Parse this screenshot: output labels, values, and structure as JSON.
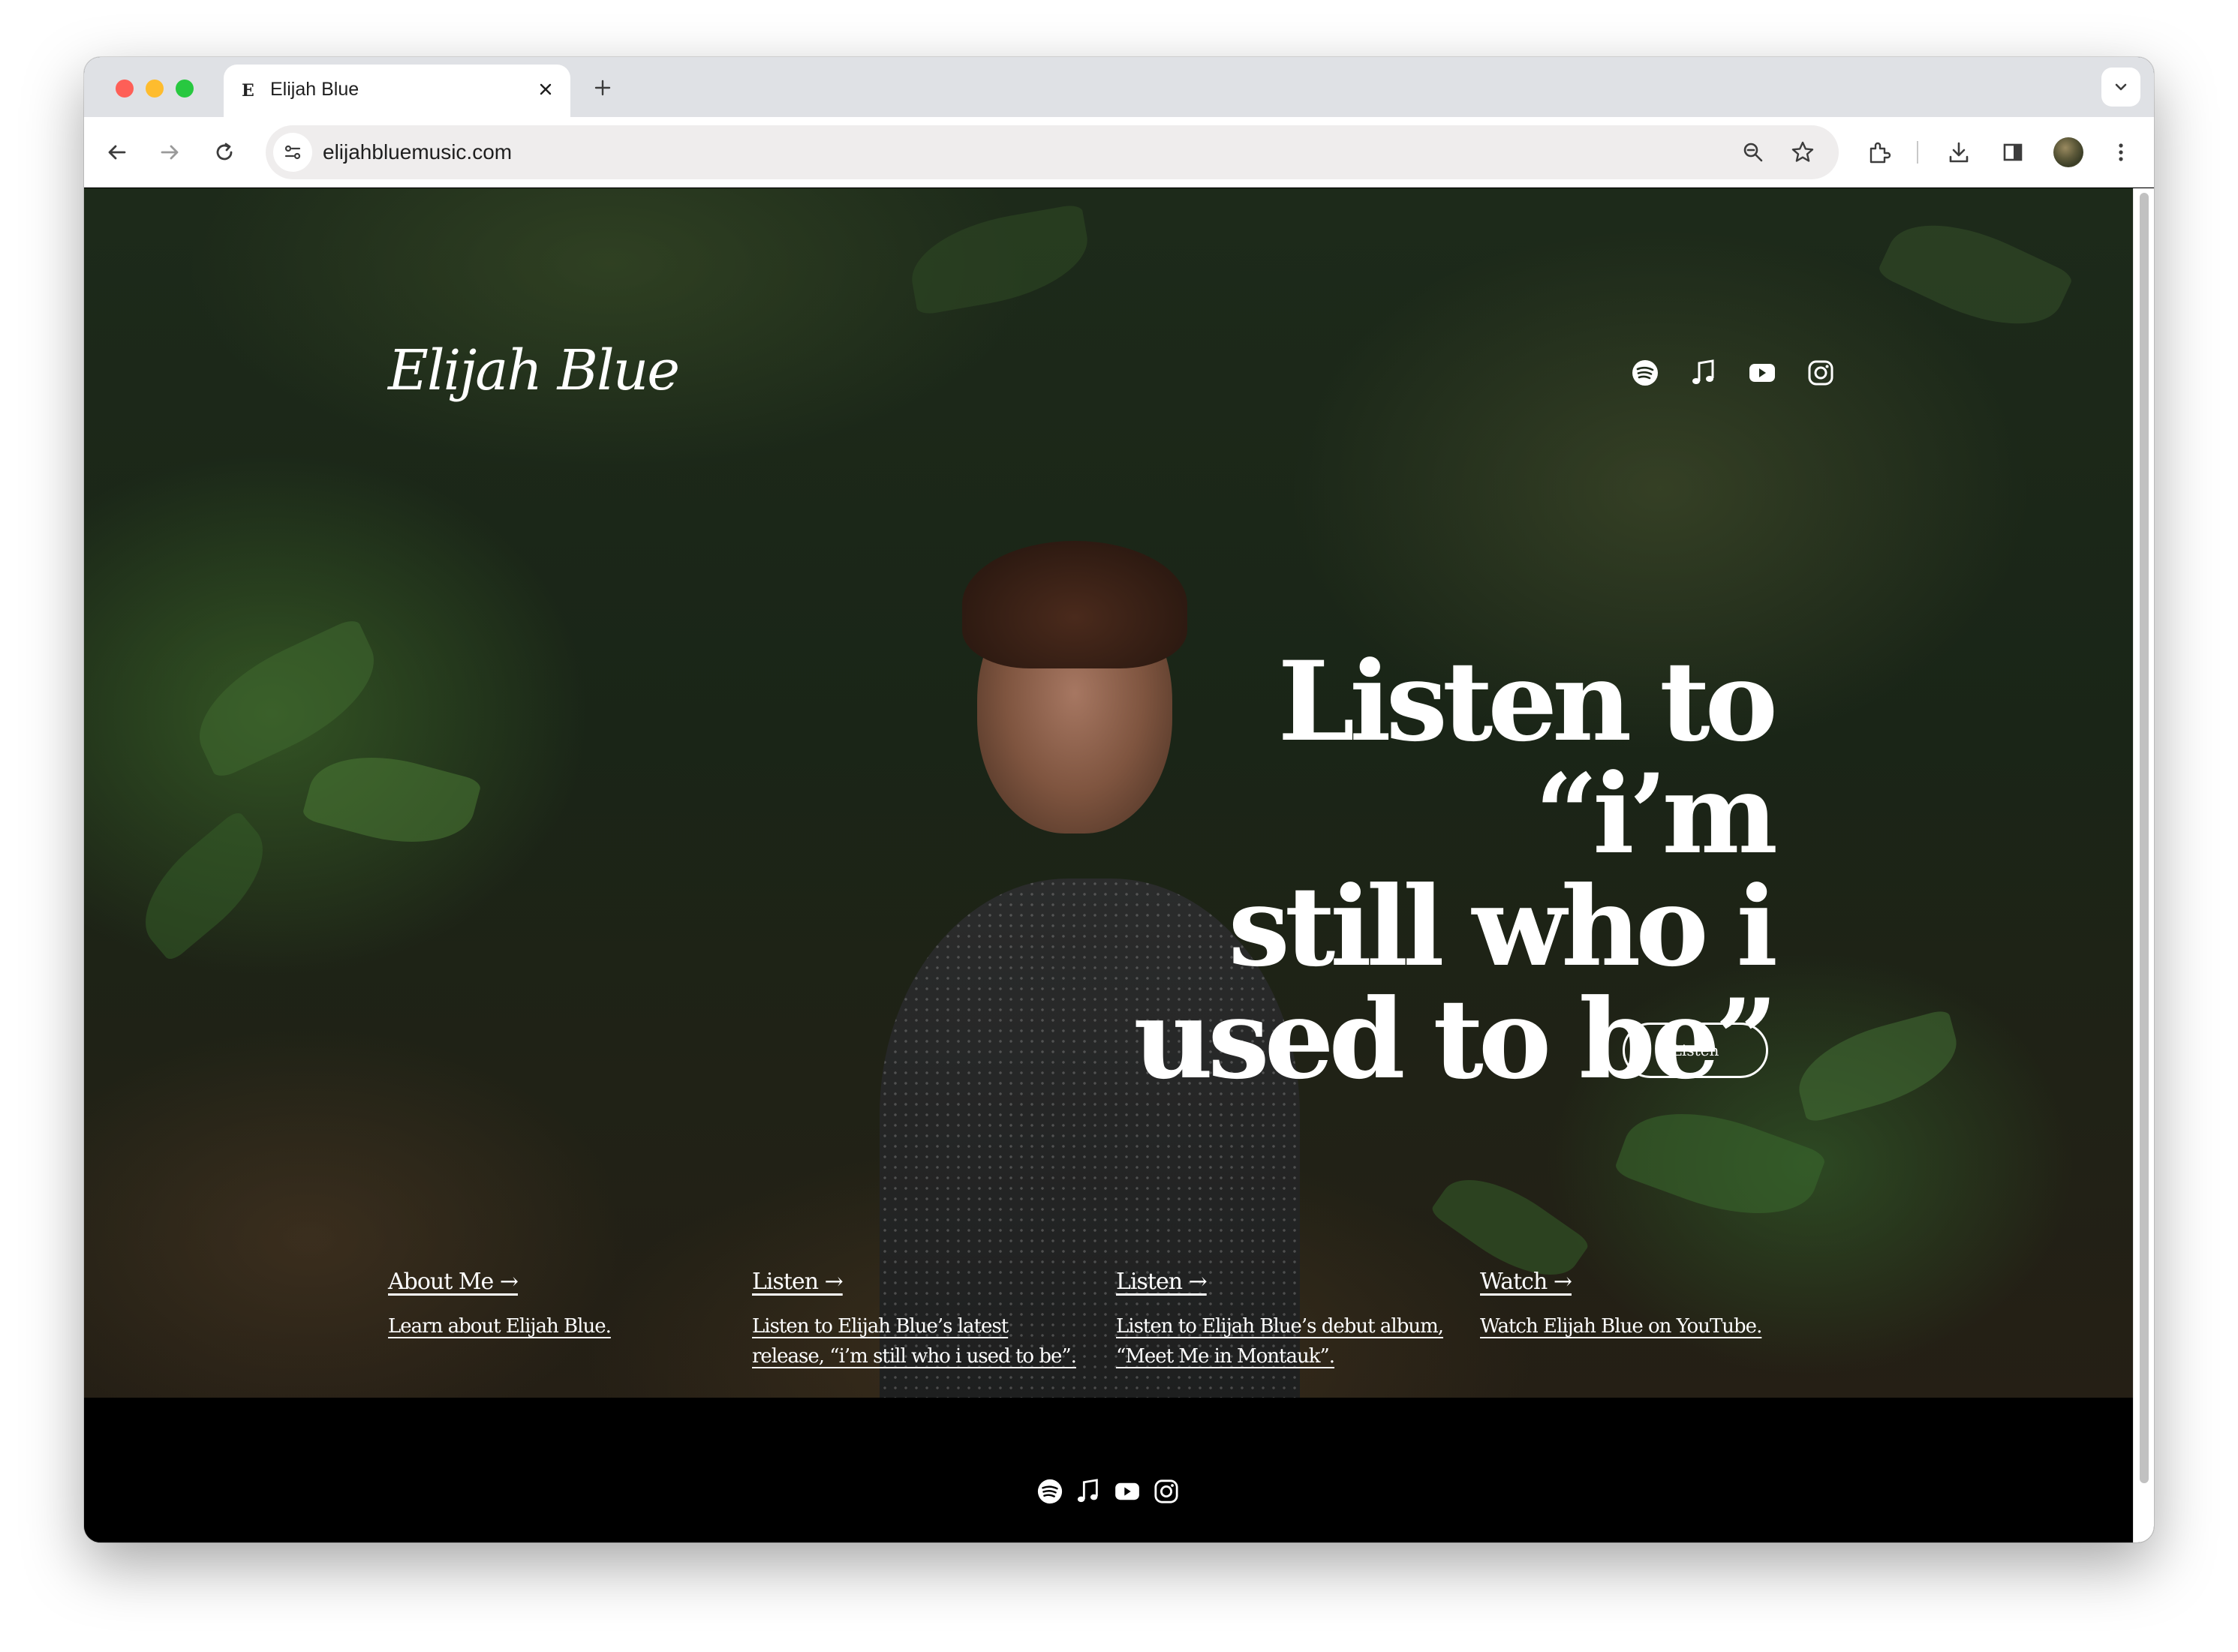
{
  "browser": {
    "tab": {
      "favicon": "E",
      "title": "Elijah Blue"
    },
    "url": "elijahbluemusic.com",
    "icons": [
      "back-icon",
      "forward-icon",
      "reload-icon",
      "site-info-icon",
      "zoom-icon",
      "bookmark-star-icon",
      "extensions-icon",
      "download-icon",
      "side-panel-icon",
      "profile-avatar",
      "more-menu-icon",
      "tab-search-icon"
    ]
  },
  "site": {
    "logo": "Elijah Blue",
    "social": [
      "spotify-icon",
      "music-note-icon",
      "youtube-icon",
      "instagram-icon"
    ],
    "hero": {
      "headline_line1": "Listen to “i’m",
      "headline_line2": "still who i",
      "headline_line3": "used to be”",
      "button_label": "Listen"
    },
    "cards": [
      {
        "title": "About Me →",
        "desc": "Learn about Elijah Blue."
      },
      {
        "title": "Listen →",
        "desc": "Listen to Elijah Blue’s latest release, “i’m still who i used to be”."
      },
      {
        "title": "Listen →",
        "desc": "Listen to Elijah Blue’s debut album, “Meet Me in Montauk”."
      },
      {
        "title": "Watch →",
        "desc": "Watch Elijah Blue on YouTube."
      }
    ]
  },
  "colors": {
    "accent": "#ffffff",
    "footer_bg": "#000000",
    "chrome_bg": "#dfe1e5"
  }
}
